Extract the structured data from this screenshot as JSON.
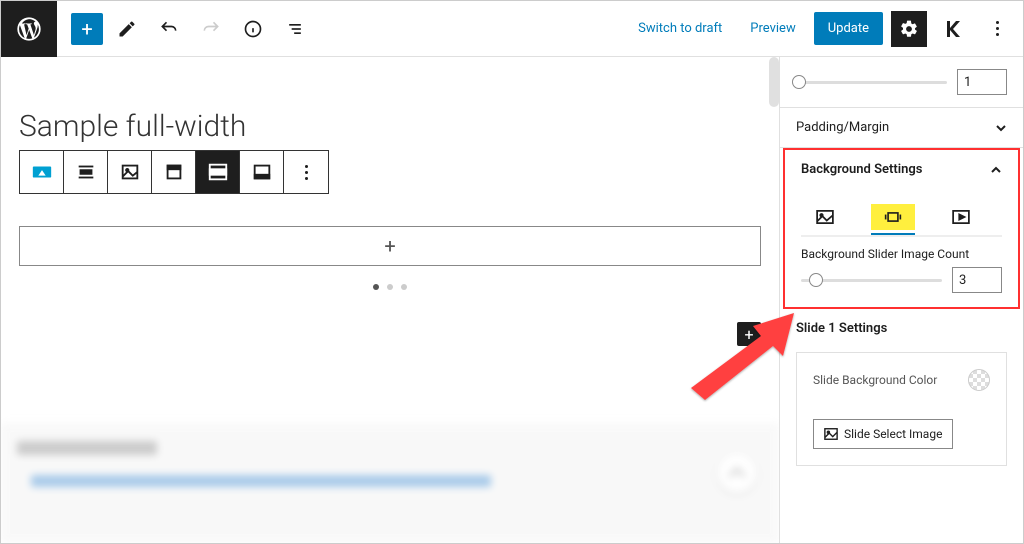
{
  "topbar": {
    "switch_draft": "Switch to draft",
    "preview": "Preview",
    "update": "Update"
  },
  "canvas": {
    "block_title": "Sample full-width",
    "add_inside": "+",
    "add_square": "+"
  },
  "sidebar": {
    "slider_top_value": "1",
    "padding_margin": "Padding/Margin",
    "bg_settings": "Background Settings",
    "bg_count_label": "Background Slider Image Count",
    "bg_count_value": "3",
    "slide1_title": "Slide 1 Settings",
    "slide_bgcolor_label": "Slide Background Color",
    "slide_select_image": "Slide Select Image"
  }
}
